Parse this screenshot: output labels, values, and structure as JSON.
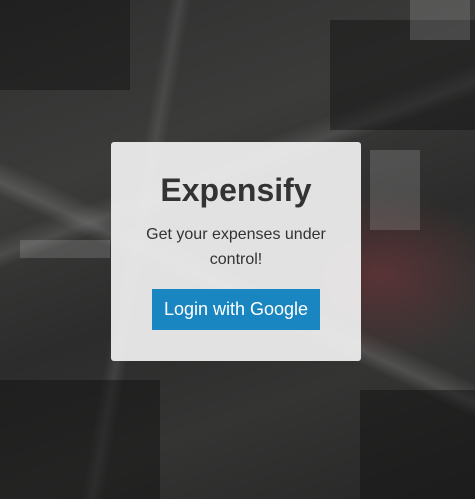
{
  "card": {
    "title": "Expensify",
    "subtitle": "Get your expenses under control!",
    "login_button_label": "Login with Google"
  },
  "colors": {
    "button_background": "#1a86c1",
    "card_background": "#f0f0f0",
    "text": "#333333"
  }
}
